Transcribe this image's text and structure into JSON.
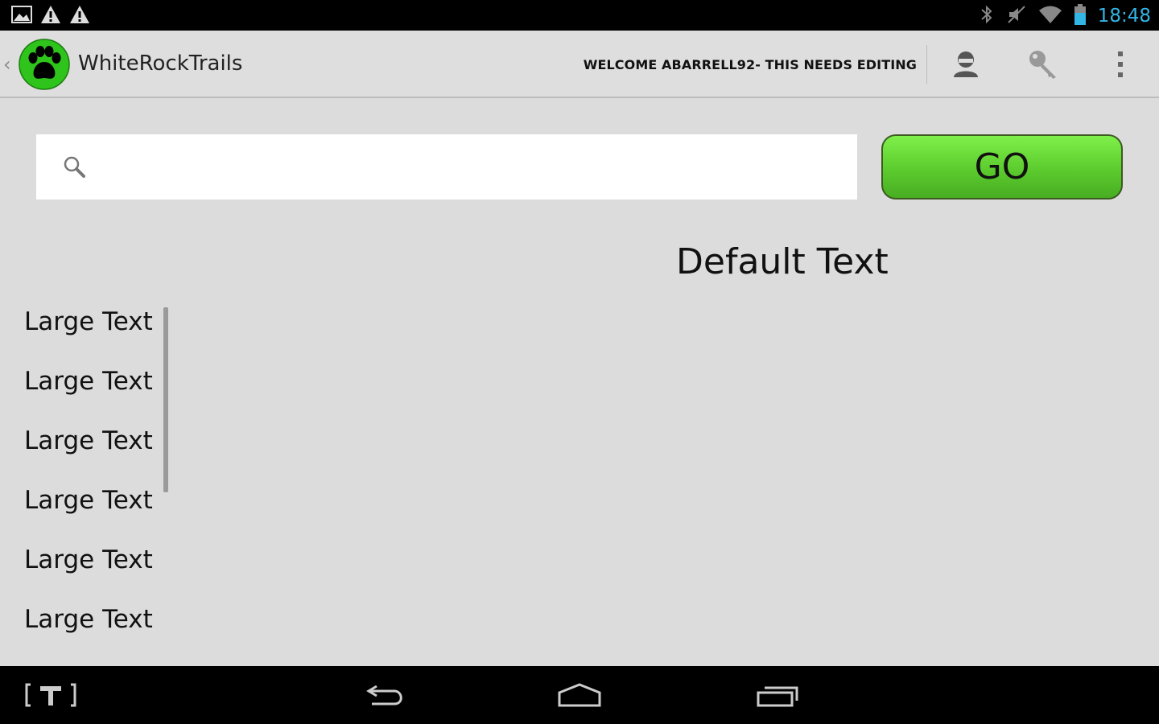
{
  "status_bar": {
    "time": "18:48",
    "left_icons": [
      "image-notification-icon",
      "warning-icon",
      "warning-icon"
    ],
    "right_icons": [
      "bluetooth-icon",
      "muted-icon",
      "wifi-icon",
      "battery-icon"
    ]
  },
  "action_bar": {
    "app_title": "WhiteRockTrails",
    "welcome": "WELCOME ABARRELL92- THIS NEEDS EDITING",
    "actions": [
      "profile-icon",
      "key-icon",
      "overflow-menu-icon"
    ]
  },
  "search": {
    "placeholder": "",
    "value": ""
  },
  "go_button": {
    "label": "GO"
  },
  "default_text": "Default Text",
  "list": {
    "items": [
      "Large Text",
      "Large Text",
      "Large Text",
      "Large Text",
      "Large Text",
      "Large Text"
    ]
  },
  "nav_bar": {
    "buttons": [
      "app-shortcut-icon",
      "back-icon",
      "home-icon",
      "recent-apps-icon"
    ]
  },
  "colors": {
    "accent_clock": "#33b5e5",
    "go_button": "#5ccb2e",
    "logo_green": "#2ec41c",
    "background": "#dcdcdc"
  }
}
